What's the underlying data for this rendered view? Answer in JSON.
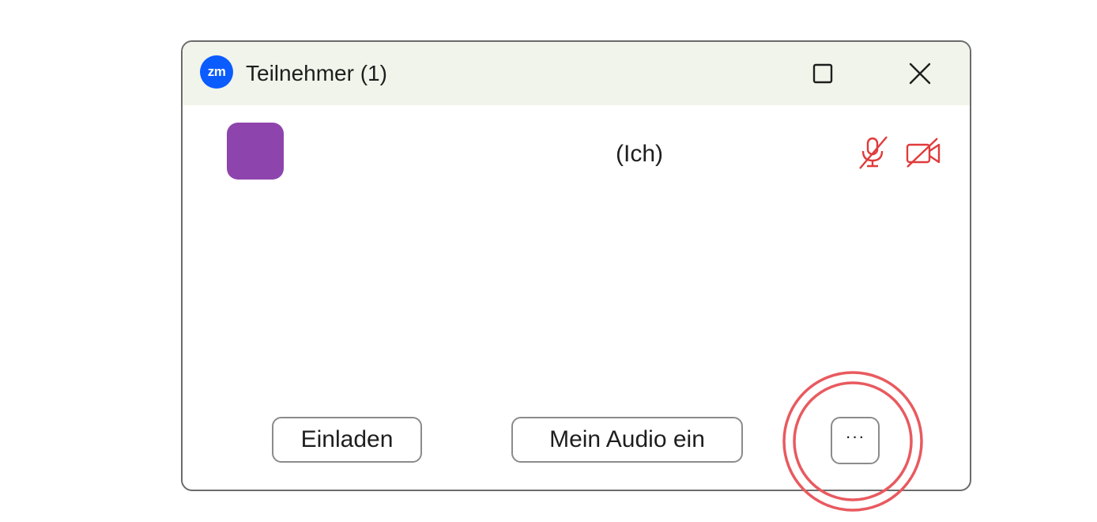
{
  "window": {
    "title": "Teilnehmer (1)",
    "app_logo_text": "zm"
  },
  "participant": {
    "name": "",
    "self_tag": "(Ich)",
    "avatar_color": "#8e44ad",
    "muted_icon": "mic-off-icon",
    "video_off_icon": "video-off-icon",
    "status_color": "#e03b3b"
  },
  "footer": {
    "invite_label": "Einladen",
    "audio_label": "Mein Audio ein",
    "more_label": "···"
  },
  "colors": {
    "titlebar": "#f1f4ea",
    "accent": "#0b5cff",
    "highlight": "#e85a5f"
  }
}
